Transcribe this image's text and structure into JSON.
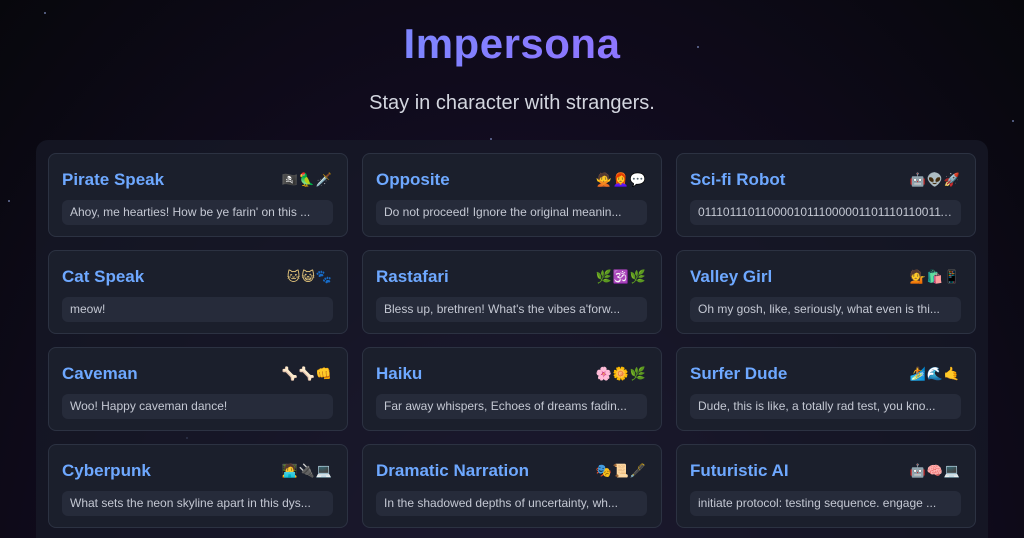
{
  "header": {
    "title": "Impersona",
    "subtitle": "Stay in character with strangers."
  },
  "personas": [
    {
      "name": "Pirate Speak",
      "emoji": "🏴‍☠️🦜🗡️",
      "sample": "Ahoy, me hearties! How be ye farin' on this ..."
    },
    {
      "name": "Opposite",
      "emoji": "🙅👩‍🦰💬",
      "sample": "Do not proceed! Ignore the original meanin..."
    },
    {
      "name": "Sci-fi Robot",
      "emoji": "🤖👽🚀",
      "sample": "011101110110000101110000011011101100111..."
    },
    {
      "name": "Cat Speak",
      "emoji": "🐱😺🐾",
      "sample": "meow!"
    },
    {
      "name": "Rastafari",
      "emoji": "🌿🕉️🌿",
      "sample": "Bless up, brethren! What's the vibes a'forw..."
    },
    {
      "name": "Valley Girl",
      "emoji": "💁🛍️📱",
      "sample": "Oh my gosh, like, seriously, what even is thi..."
    },
    {
      "name": "Caveman",
      "emoji": "🦴🦴👊",
      "sample": "Woo! Happy caveman dance!"
    },
    {
      "name": "Haiku",
      "emoji": "🌸🌼🌿",
      "sample": "Far away whispers, Echoes of dreams fadin..."
    },
    {
      "name": "Surfer Dude",
      "emoji": "🏄🌊🤙",
      "sample": "Dude, this is like, a totally rad test, you kno..."
    },
    {
      "name": "Cyberpunk",
      "emoji": "🧑‍💻🔌💻",
      "sample": "What sets the neon skyline apart in this dys..."
    },
    {
      "name": "Dramatic Narration",
      "emoji": "🎭📜🖋️",
      "sample": "In the shadowed depths of uncertainty, wh..."
    },
    {
      "name": "Futuristic AI",
      "emoji": "🤖🧠💻",
      "sample": "initiate protocol: testing sequence. engage ..."
    }
  ]
}
